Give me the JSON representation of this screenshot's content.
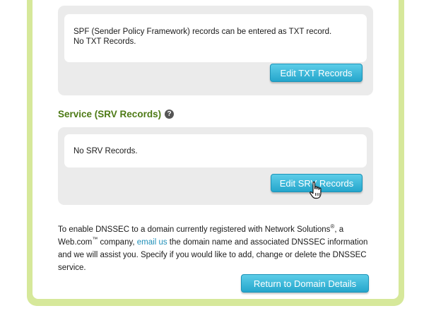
{
  "txt_panel": {
    "description": "SPF (Sender Policy Framework) records can be entered as TXT record.",
    "status": "No TXT Records.",
    "button_label": "Edit TXT Records"
  },
  "srv_section": {
    "title": "Service (SRV Records)",
    "help_glyph": "?",
    "status": "No SRV Records.",
    "button_label": "Edit SRV Records"
  },
  "dnssec_info": {
    "part1": "To enable DNSSEC to a domain currently registered with Network Solutions",
    "registered_mark": "®",
    "part2": ", a Web.com",
    "trademark": "™",
    "part3": " company, ",
    "link_label": "email us",
    "part4": " the domain name and associated DNSSEC information and we will assist you. Specify if you would like to add, change or delete the DNSSEC service."
  },
  "return_button_label": "Return to Domain Details",
  "colors": {
    "frame_green": "#d6e89a",
    "section_title_green": "#4d7a15",
    "button_blue": "#25a6cc",
    "link_blue": "#1f8fb8",
    "panel_gray": "#ebebeb"
  },
  "icons": {
    "help": "help-icon",
    "cursor": "hand-pointer-icon"
  }
}
